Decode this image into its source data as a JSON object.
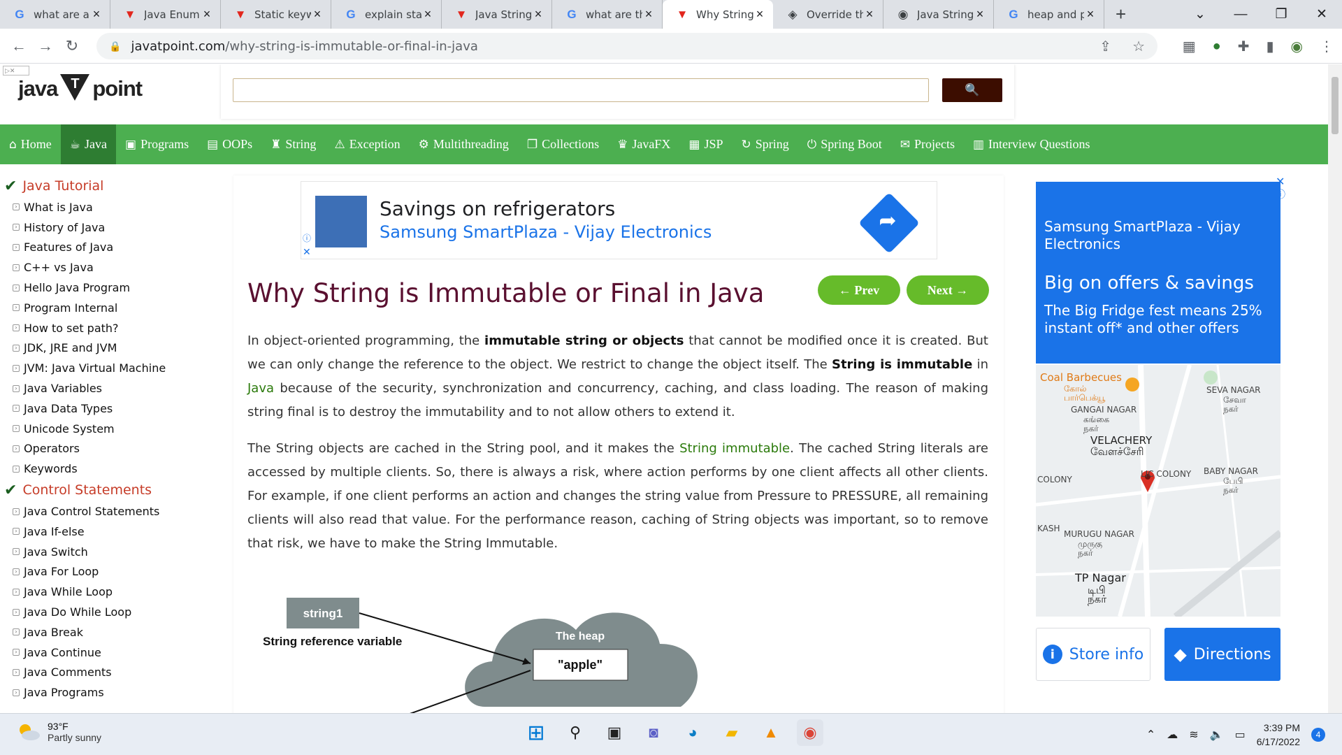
{
  "browser": {
    "tabs": [
      {
        "title": "what are all",
        "icon": "google-icon",
        "fav": "G",
        "fav_class": "fav-g"
      },
      {
        "title": "Java Enum",
        "icon": "javatpoint-icon",
        "fav": "▼",
        "fav_class": "fav-v"
      },
      {
        "title": "Static keyw",
        "icon": "javatpoint-icon",
        "fav": "▼",
        "fav_class": "fav-v"
      },
      {
        "title": "explain stat",
        "icon": "google-icon",
        "fav": "G",
        "fav_class": "fav-g"
      },
      {
        "title": "Java String",
        "icon": "javatpoint-icon",
        "fav": "▼",
        "fav_class": "fav-v"
      },
      {
        "title": "what are th",
        "icon": "google-icon",
        "fav": "G",
        "fav_class": "fav-g"
      },
      {
        "title": "Why String",
        "icon": "javatpoint-icon",
        "fav": "▼",
        "fav_class": "fav-v",
        "active": true
      },
      {
        "title": "Override th",
        "icon": "site-icon",
        "fav": "◈",
        "fav_class": ""
      },
      {
        "title": "Java String",
        "icon": "site-icon",
        "fav": "◉",
        "fav_class": ""
      },
      {
        "title": "heap and p",
        "icon": "google-icon",
        "fav": "G",
        "fav_class": "fav-g"
      }
    ],
    "url_domain": "javatpoint.com",
    "url_path": "/why-string-is-immutable-or-final-in-java"
  },
  "site": {
    "logo_left": "java",
    "logo_right": "point",
    "search_placeholder": ""
  },
  "menu": [
    {
      "label": "Home",
      "icon": "⌂"
    },
    {
      "label": "Java",
      "icon": "☕",
      "active": true
    },
    {
      "label": "Programs",
      "icon": "▣"
    },
    {
      "label": "OOPs",
      "icon": "▤"
    },
    {
      "label": "String",
      "icon": "♜"
    },
    {
      "label": "Exception",
      "icon": "⚠"
    },
    {
      "label": "Multithreading",
      "icon": "⚙"
    },
    {
      "label": "Collections",
      "icon": "❐"
    },
    {
      "label": "JavaFX",
      "icon": "♛"
    },
    {
      "label": "JSP",
      "icon": "▦"
    },
    {
      "label": "Spring",
      "icon": "↻"
    },
    {
      "label": "Spring Boot",
      "icon": "⏻"
    },
    {
      "label": "Projects",
      "icon": "✉"
    },
    {
      "label": "Interview Questions",
      "icon": "▥"
    }
  ],
  "sidebar": {
    "sections": [
      {
        "heading": "Java Tutorial",
        "items": [
          "What is Java",
          "History of Java",
          "Features of Java",
          "C++ vs Java",
          "Hello Java Program",
          "Program Internal",
          "How to set path?",
          "JDK, JRE and JVM",
          "JVM: Java Virtual Machine",
          "Java Variables",
          "Java Data Types",
          "Unicode System",
          "Operators",
          "Keywords"
        ]
      },
      {
        "heading": "Control Statements",
        "items": [
          "Java Control Statements",
          "Java If-else",
          "Java Switch",
          "Java For Loop",
          "Java While Loop",
          "Java Do While Loop",
          "Java Break",
          "Java Continue",
          "Java Comments",
          "Java Programs"
        ]
      }
    ]
  },
  "ad_top": {
    "headline": "Savings on refrigerators",
    "advertiser": "Samsung SmartPlaza - Vijay Electronics"
  },
  "article": {
    "title": "Why String is Immutable or Final in Java",
    "prev_label": "← Prev",
    "next_label": "Next →",
    "p1_a": "In object-oriented programming, the ",
    "p1_b": "immutable string or objects",
    "p1_c": " that cannot be modified once it is created. But we can only change the reference to the object. We restrict to change the object itself. The ",
    "p1_d": "String is immutable",
    "p1_e": " in ",
    "p1_link": "Java",
    "p1_f": " because of the security, synchronization and concurrency, caching, and class loading. The reason of making string final is to destroy the immutability and to not allow others to extend it.",
    "p2_a": "The String objects are cached in the String pool, and it makes the ",
    "p2_link": "String immutable",
    "p2_b": ". The cached String literals are accessed by multiple clients. So, there is always a risk, where action performs by one client affects all other clients. For example, if one client performs an action and changes the string value from Pressure to PRESSURE, all remaining clients will also read that value. For the performance reason, caching of String objects was important, so to remove that risk, we have to make the String Immutable.",
    "diagram": {
      "box1": "string1",
      "ref_label": "String reference variable",
      "heap_label": "The heap",
      "value": "\"apple\""
    }
  },
  "ad_right": {
    "advertiser": "Samsung SmartPlaza - Vijay Electronics",
    "headline": "Big on offers & savings",
    "body": "The Big Fridge fest means 25% instant off* and other offers",
    "store_info": "Store info",
    "directions": "Directions",
    "map_labels": {
      "coal": "Coal Barbecues",
      "coal_ta": "கோல் பார்பெக்யூ",
      "gangai": "GANGAI NAGAR",
      "gangai_ta": "கங்கை நகர்",
      "velachery": "VELACHERY",
      "velachery_ta": "வேளச்சேரி",
      "seva": "SEVA NAGAR",
      "seva_ta": "சேவா நகர்",
      "colony": "COLONY",
      "lic": "LIC COLONY",
      "baby": "BABY NAGAR",
      "baby_ta": "பேபி நகர்",
      "kash": "KASH",
      "murugu": "MURUGU NAGAR",
      "murugu_ta": "முருகு நகர்",
      "tp": "TP Nagar",
      "tp_ta": "டிபி நகர்"
    }
  },
  "taskbar": {
    "temp": "93°F",
    "weather": "Partly sunny",
    "time": "3:39 PM",
    "date": "6/17/2022",
    "notifications": "4"
  }
}
